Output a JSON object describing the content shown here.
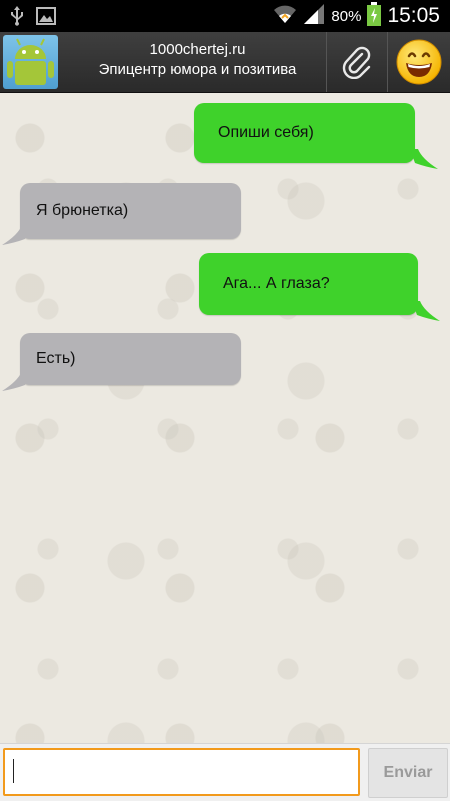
{
  "status_bar": {
    "icons": [
      "usb-icon",
      "image-icon",
      "wifi-icon",
      "signal-icon",
      "battery-charging-icon"
    ],
    "battery_percent": "80%",
    "time": "15:05"
  },
  "header": {
    "title_line1": "1000chertej.ru",
    "title_line2": "Эпицентр юмора и позитива",
    "avatar_icon": "android-robot-icon",
    "attach_icon": "paperclip-icon",
    "emoji_icon": "smiley-emoji-icon"
  },
  "messages": [
    {
      "direction": "outgoing",
      "text": "Опиши себя)"
    },
    {
      "direction": "incoming",
      "text": "Я брюнетка)"
    },
    {
      "direction": "outgoing",
      "text": "Ага... А глаза?"
    },
    {
      "direction": "incoming",
      "text": "Есть)"
    }
  ],
  "composer": {
    "input_value": "",
    "send_label": "Enviar"
  },
  "colors": {
    "outgoing_bubble": "#3fd22b",
    "incoming_bubble": "#b4b3b6",
    "input_focus_border": "#f29a1c"
  }
}
